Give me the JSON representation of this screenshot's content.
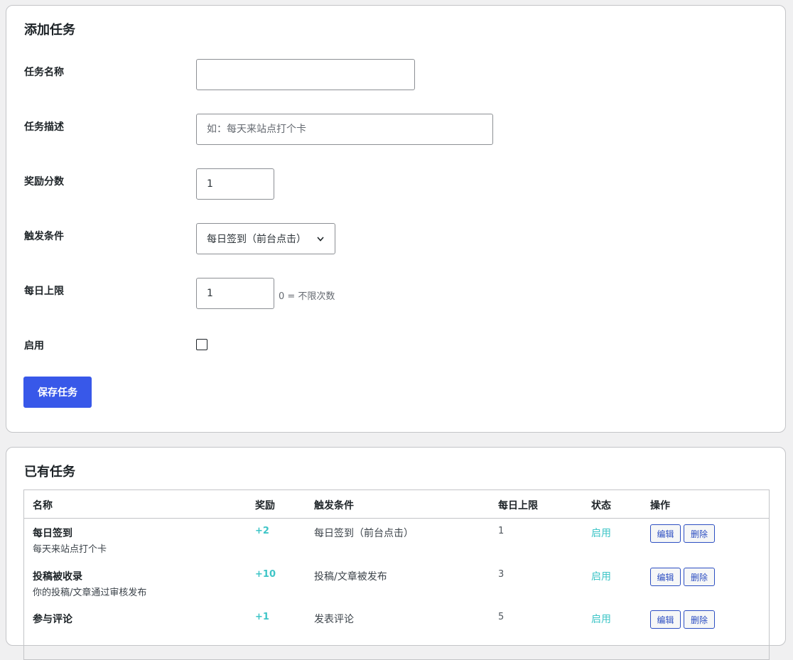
{
  "add_section": {
    "title": "添加任务",
    "fields": {
      "name": {
        "label": "任务名称",
        "value": "",
        "placeholder": ""
      },
      "description": {
        "label": "任务描述",
        "value": "",
        "placeholder": "如：每天来站点打个卡"
      },
      "reward": {
        "label": "奖励分数",
        "value": "1"
      },
      "trigger": {
        "label": "触发条件",
        "selected": "每日签到（前台点击）"
      },
      "daily_limit": {
        "label": "每日上限",
        "value": "1",
        "hint": "0 = 不限次数"
      },
      "enabled": {
        "label": "启用",
        "checked": false
      }
    },
    "save_label": "保存任务"
  },
  "list_section": {
    "title": "已有任务",
    "headers": {
      "name": "名称",
      "reward": "奖励",
      "trigger": "触发条件",
      "limit": "每日上限",
      "status": "状态",
      "actions": "操作"
    },
    "rows": [
      {
        "name": "每日签到",
        "desc": "每天来站点打个卡",
        "reward": "+2",
        "trigger": "每日签到（前台点击）",
        "limit": "1",
        "status": "启用",
        "edit": "编辑",
        "delete": "删除"
      },
      {
        "name": "投稿被收录",
        "desc": "你的投稿/文章通过审核发布",
        "reward": "+10",
        "trigger": "投稿/文章被发布",
        "limit": "3",
        "status": "启用",
        "edit": "编辑",
        "delete": "删除"
      },
      {
        "name": "参与评论",
        "desc": "",
        "reward": "+1",
        "trigger": "发表评论",
        "limit": "5",
        "status": "启用",
        "edit": "编辑",
        "delete": "删除"
      }
    ]
  },
  "colors": {
    "primary": "#3858e9",
    "accent_teal": "#3ec5c7",
    "border": "#c3c4c7",
    "background": "#f0f0f1"
  }
}
